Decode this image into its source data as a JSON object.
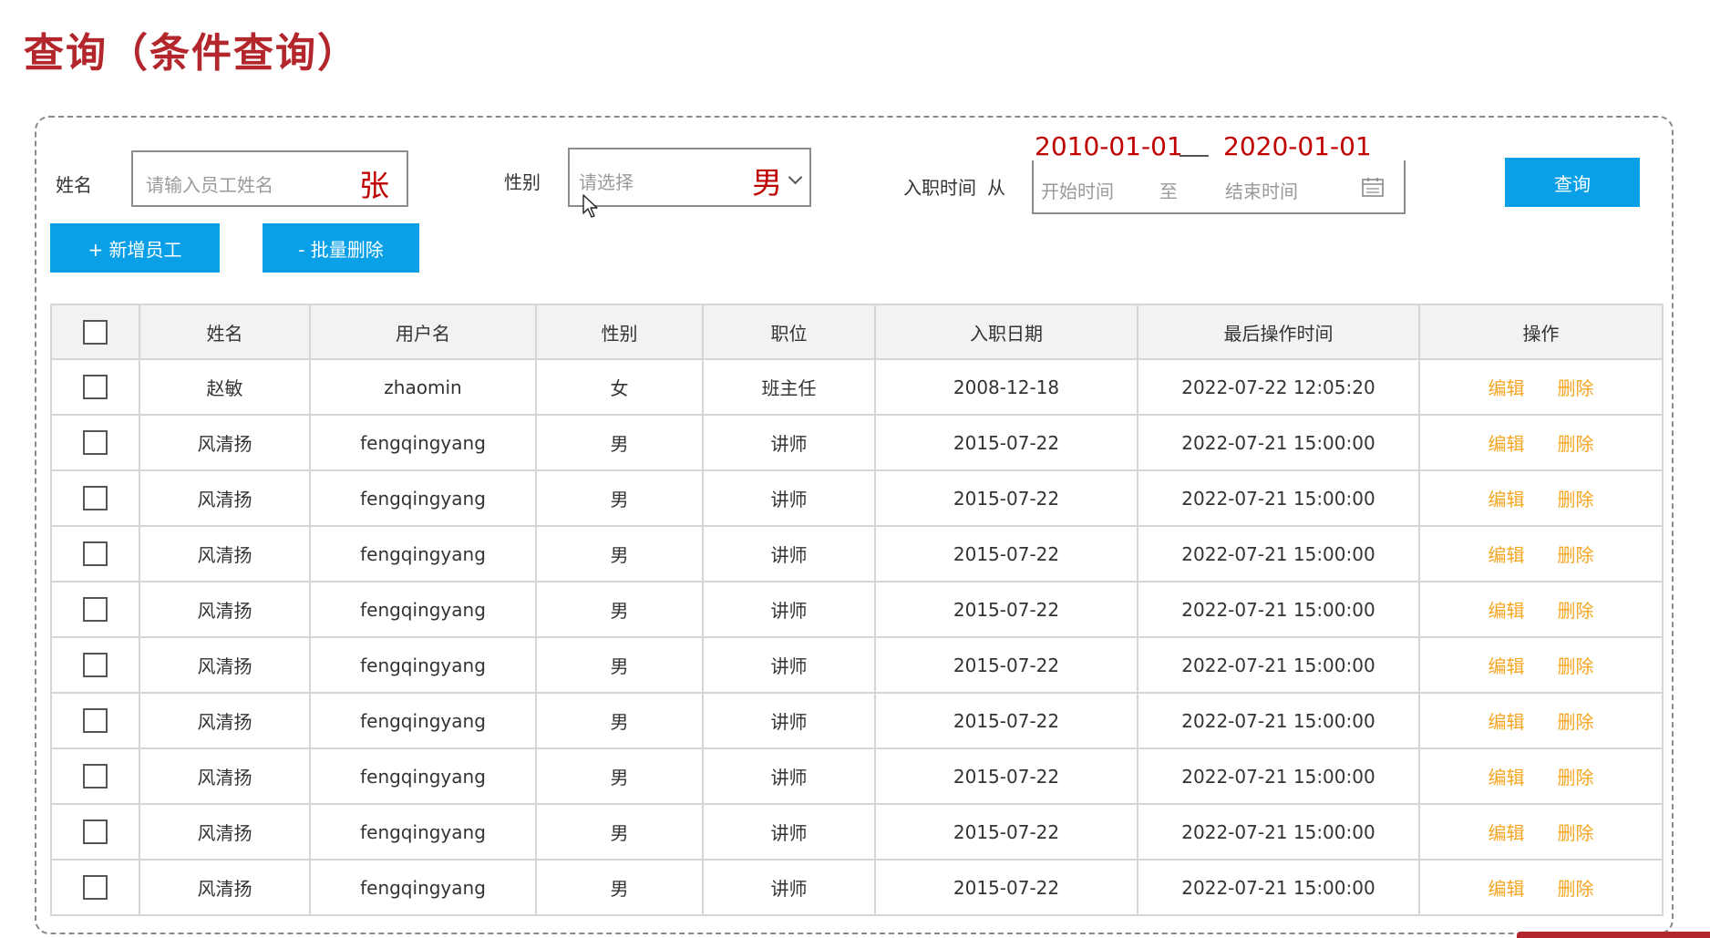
{
  "page": {
    "title": "查询（条件查询）"
  },
  "filters": {
    "name_label": "姓名",
    "name_placeholder": "请输入员工姓名",
    "name_annotation": "张",
    "gender_label": "性别",
    "gender_placeholder": "请选择",
    "gender_annotation": "男",
    "hire_label": "入职时间",
    "hire_from": "从",
    "start_placeholder": "开始时间",
    "range_sep": "至",
    "end_placeholder": "结束时间",
    "start_annotation": "2010-01-01",
    "end_annotation": "2020-01-01",
    "search_button": "查询"
  },
  "toolbar": {
    "add_button": "+ 新增员工",
    "batch_delete_button": "- 批量删除"
  },
  "table": {
    "columns": [
      "姓名",
      "用户名",
      "性别",
      "职位",
      "入职日期",
      "最后操作时间",
      "操作"
    ],
    "rows": [
      {
        "name": "赵敏",
        "username": "zhaomin",
        "gender": "女",
        "position": "班主任",
        "entry_date": "2008-12-18",
        "update_time": "2022-07-22 12:05:20",
        "edit": "编辑",
        "delete": "删除"
      },
      {
        "name": "风清扬",
        "username": "fengqingyang",
        "gender": "男",
        "position": "讲师",
        "entry_date": "2015-07-22",
        "update_time": "2022-07-21 15:00:00",
        "edit": "编辑",
        "delete": "删除"
      },
      {
        "name": "风清扬",
        "username": "fengqingyang",
        "gender": "男",
        "position": "讲师",
        "entry_date": "2015-07-22",
        "update_time": "2022-07-21 15:00:00",
        "edit": "编辑",
        "delete": "删除"
      },
      {
        "name": "风清扬",
        "username": "fengqingyang",
        "gender": "男",
        "position": "讲师",
        "entry_date": "2015-07-22",
        "update_time": "2022-07-21 15:00:00",
        "edit": "编辑",
        "delete": "删除"
      },
      {
        "name": "风清扬",
        "username": "fengqingyang",
        "gender": "男",
        "position": "讲师",
        "entry_date": "2015-07-22",
        "update_time": "2022-07-21 15:00:00",
        "edit": "编辑",
        "delete": "删除"
      },
      {
        "name": "风清扬",
        "username": "fengqingyang",
        "gender": "男",
        "position": "讲师",
        "entry_date": "2015-07-22",
        "update_time": "2022-07-21 15:00:00",
        "edit": "编辑",
        "delete": "删除"
      },
      {
        "name": "风清扬",
        "username": "fengqingyang",
        "gender": "男",
        "position": "讲师",
        "entry_date": "2015-07-22",
        "update_time": "2022-07-21 15:00:00",
        "edit": "编辑",
        "delete": "删除"
      },
      {
        "name": "风清扬",
        "username": "fengqingyang",
        "gender": "男",
        "position": "讲师",
        "entry_date": "2015-07-22",
        "update_time": "2022-07-21 15:00:00",
        "edit": "编辑",
        "delete": "删除"
      },
      {
        "name": "风清扬",
        "username": "fengqingyang",
        "gender": "男",
        "position": "讲师",
        "entry_date": "2015-07-22",
        "update_time": "2022-07-21 15:00:00",
        "edit": "编辑",
        "delete": "删除"
      },
      {
        "name": "风清扬",
        "username": "fengqingyang",
        "gender": "男",
        "position": "讲师",
        "entry_date": "2015-07-22",
        "update_time": "2022-07-21 15:00:00",
        "edit": "编辑",
        "delete": "删除"
      }
    ]
  },
  "colors": {
    "title": "#b3262b",
    "primary_button": "#0aa0e8",
    "action_link": "#f5a623",
    "annotation": "#c00000"
  },
  "icons": {
    "gender_dropdown": "chevron-down-icon",
    "date_range": "calendar-icon",
    "pointer": "mouse-cursor-icon"
  }
}
